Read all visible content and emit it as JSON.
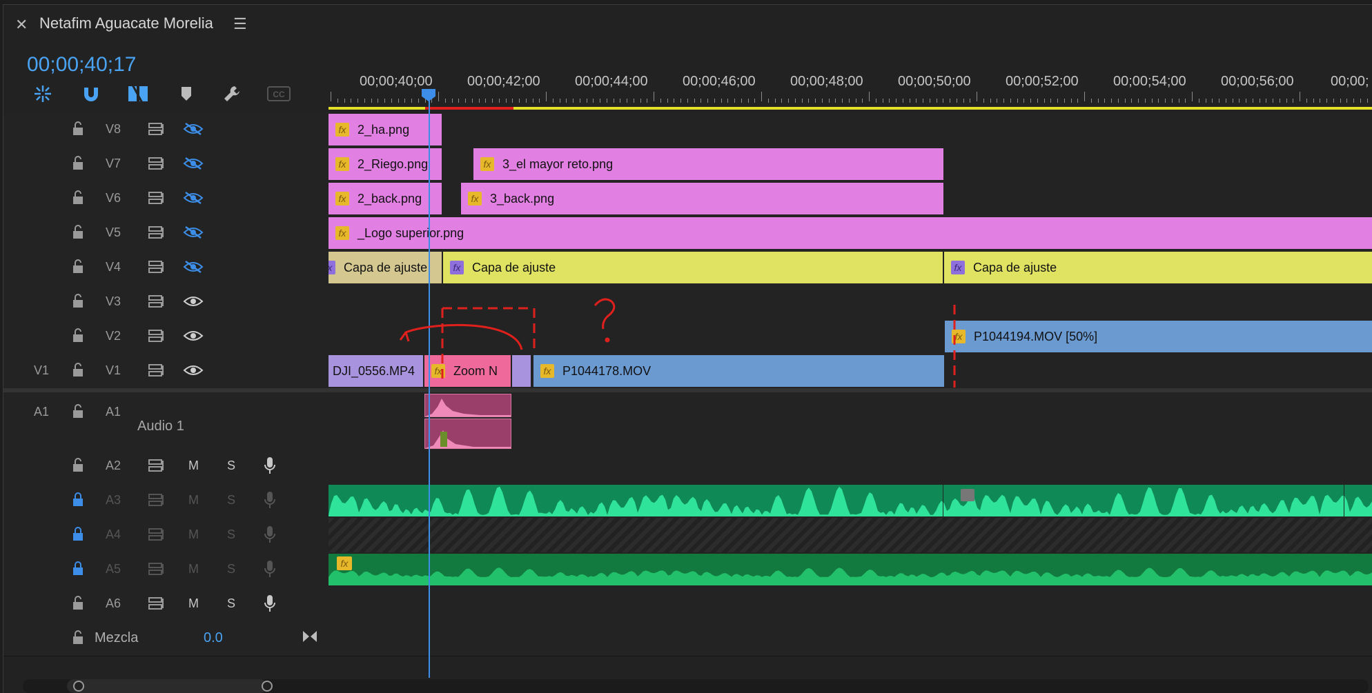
{
  "sequence": {
    "title": "Netafim Aguacate Morelia",
    "timecode": "00;00;40;17"
  },
  "ruler": {
    "labels": [
      "00;00;40;00",
      "00;00;42;00",
      "00;00;44;00",
      "00;00;46;00",
      "00;00;48;00",
      "00;00;50;00",
      "00;00;52;00",
      "00;00;54;00",
      "00;00;56;00",
      "00;00;"
    ]
  },
  "tracks": {
    "v8": {
      "name": "V8",
      "clips": [
        "2_ha.png"
      ]
    },
    "v7": {
      "name": "V7",
      "clips": [
        "2_Riego.png",
        "3_el mayor reto.png"
      ]
    },
    "v6": {
      "name": "V6",
      "clips": [
        "2_back.png",
        "3_back.png"
      ]
    },
    "v5": {
      "name": "V5",
      "clips": [
        "_Logo superior.png"
      ]
    },
    "v4": {
      "name": "V4",
      "clips": [
        "Capa de ajuste",
        "Capa de ajuste",
        "Capa de ajuste"
      ]
    },
    "v3": {
      "name": "V3"
    },
    "v2": {
      "name": "V2",
      "clips": [
        "P1044194.MOV [50%]"
      ]
    },
    "v1": {
      "source": "V1",
      "name": "V1",
      "clips": [
        "DJI_0556.MP4",
        "Zoom N",
        "P1044178.MOV"
      ]
    },
    "a1": {
      "source": "A1",
      "name": "A1",
      "label": "Audio 1"
    },
    "a2": {
      "name": "A2",
      "m": "M",
      "s": "S"
    },
    "a3": {
      "name": "A3",
      "m": "M",
      "s": "S"
    },
    "a4": {
      "name": "A4",
      "m": "M",
      "s": "S"
    },
    "a5": {
      "name": "A5",
      "m": "M",
      "s": "S"
    },
    "a6": {
      "name": "A6",
      "m": "M",
      "s": "S"
    },
    "mix": {
      "label": "Mezcla",
      "value": "0.0"
    }
  },
  "icons": [
    "close-icon",
    "menu-icon",
    "snap-icon",
    "linked-selection-icon",
    "insert-sequence-icon",
    "marker-icon",
    "wrench-icon",
    "captions-icon",
    "lock-icon",
    "toggle-output-icon",
    "eye-icon",
    "microphone-icon"
  ],
  "colors": {
    "accent": "#3d8ee8",
    "video_pink": "#e27fe3",
    "adjustment_yellow": "#e0e361",
    "video_blue": "#6b9ad1",
    "audio_green": "#1aa96f",
    "annotation_red": "#e0201c"
  }
}
